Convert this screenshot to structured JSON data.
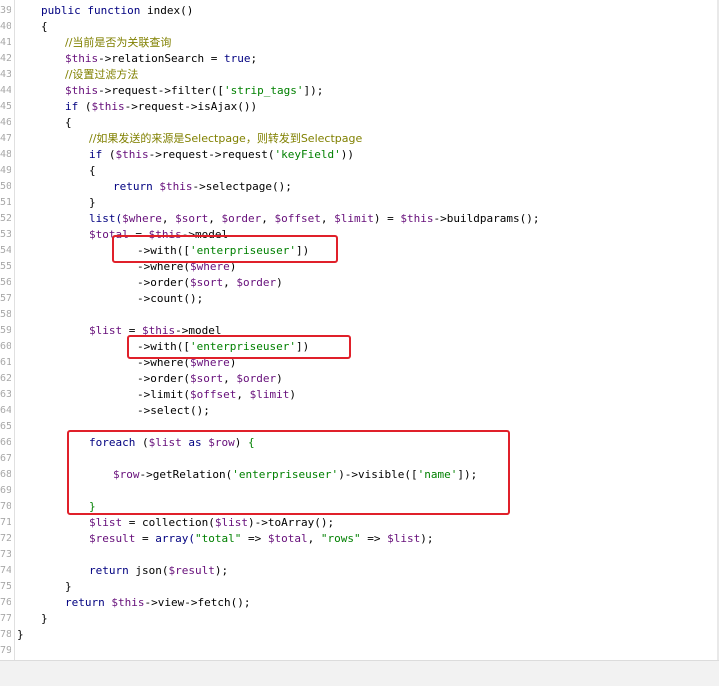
{
  "editor": {
    "lines": [
      {
        "num": "39",
        "indent": 0,
        "tokens": [
          {
            "t": "public ",
            "c": "kw"
          },
          {
            "t": "function ",
            "c": "kw"
          },
          {
            "t": "index()",
            "c": "plain"
          }
        ]
      },
      {
        "num": "40",
        "indent": 0,
        "tokens": [
          {
            "t": "{",
            "c": "plain"
          }
        ]
      },
      {
        "num": "41",
        "indent": 1,
        "tokens": [
          {
            "t": "//当前是否为关联查询",
            "c": "cmt"
          }
        ]
      },
      {
        "num": "42",
        "indent": 1,
        "tokens": [
          {
            "t": "$this",
            "c": "var"
          },
          {
            "t": "->relationSearch = ",
            "c": "plain"
          },
          {
            "t": "true",
            "c": "kw"
          },
          {
            "t": ";",
            "c": "plain"
          }
        ]
      },
      {
        "num": "43",
        "indent": 1,
        "tokens": [
          {
            "t": "//设置过滤方法",
            "c": "cmt"
          }
        ]
      },
      {
        "num": "44",
        "indent": 1,
        "tokens": [
          {
            "t": "$this",
            "c": "var"
          },
          {
            "t": "->request->filter([",
            "c": "plain"
          },
          {
            "t": "'strip_tags'",
            "c": "str"
          },
          {
            "t": "]);",
            "c": "plain"
          }
        ]
      },
      {
        "num": "45",
        "indent": 1,
        "tokens": [
          {
            "t": "if ",
            "c": "kw"
          },
          {
            "t": "(",
            "c": "plain"
          },
          {
            "t": "$this",
            "c": "var"
          },
          {
            "t": "->request->isAjax())",
            "c": "plain"
          }
        ]
      },
      {
        "num": "46",
        "indent": 1,
        "tokens": [
          {
            "t": "{",
            "c": "plain"
          }
        ]
      },
      {
        "num": "47",
        "indent": 2,
        "tokens": [
          {
            "t": "//如果发送的来源是Selectpage，则转发到Selectpage",
            "c": "cmt"
          }
        ]
      },
      {
        "num": "48",
        "indent": 2,
        "tokens": [
          {
            "t": "if ",
            "c": "kw"
          },
          {
            "t": "(",
            "c": "plain"
          },
          {
            "t": "$this",
            "c": "var"
          },
          {
            "t": "->request->request(",
            "c": "plain"
          },
          {
            "t": "'keyField'",
            "c": "str"
          },
          {
            "t": "))",
            "c": "plain"
          }
        ]
      },
      {
        "num": "49",
        "indent": 2,
        "tokens": [
          {
            "t": "{",
            "c": "plain"
          }
        ]
      },
      {
        "num": "50",
        "indent": 3,
        "tokens": [
          {
            "t": "return ",
            "c": "kw"
          },
          {
            "t": "$this",
            "c": "var"
          },
          {
            "t": "->selectpage();",
            "c": "plain"
          }
        ]
      },
      {
        "num": "51",
        "indent": 2,
        "tokens": [
          {
            "t": "}",
            "c": "plain"
          }
        ]
      },
      {
        "num": "52",
        "indent": 2,
        "tokens": [
          {
            "t": "list(",
            "c": "kw"
          },
          {
            "t": "$where",
            "c": "var"
          },
          {
            "t": ", ",
            "c": "plain"
          },
          {
            "t": "$sort",
            "c": "var"
          },
          {
            "t": ", ",
            "c": "plain"
          },
          {
            "t": "$order",
            "c": "var"
          },
          {
            "t": ", ",
            "c": "plain"
          },
          {
            "t": "$offset",
            "c": "var"
          },
          {
            "t": ", ",
            "c": "plain"
          },
          {
            "t": "$limit",
            "c": "var"
          },
          {
            "t": ") = ",
            "c": "plain"
          },
          {
            "t": "$this",
            "c": "var"
          },
          {
            "t": "->buildparams();",
            "c": "plain"
          }
        ]
      },
      {
        "num": "53",
        "indent": 2,
        "tokens": [
          {
            "t": "$total",
            "c": "var"
          },
          {
            "t": " = ",
            "c": "plain"
          },
          {
            "t": "$this",
            "c": "var"
          },
          {
            "t": "->model",
            "c": "plain"
          }
        ]
      },
      {
        "num": "54",
        "indent": 4,
        "tokens": [
          {
            "t": "->with([",
            "c": "plain"
          },
          {
            "t": "'enterpriseuser'",
            "c": "str"
          },
          {
            "t": "])",
            "c": "plain"
          }
        ]
      },
      {
        "num": "55",
        "indent": 4,
        "tokens": [
          {
            "t": "->where(",
            "c": "plain"
          },
          {
            "t": "$where",
            "c": "var"
          },
          {
            "t": ")",
            "c": "plain"
          }
        ]
      },
      {
        "num": "56",
        "indent": 4,
        "tokens": [
          {
            "t": "->order(",
            "c": "plain"
          },
          {
            "t": "$sort",
            "c": "var"
          },
          {
            "t": ", ",
            "c": "plain"
          },
          {
            "t": "$order",
            "c": "var"
          },
          {
            "t": ")",
            "c": "plain"
          }
        ]
      },
      {
        "num": "57",
        "indent": 4,
        "tokens": [
          {
            "t": "->count();",
            "c": "plain"
          }
        ]
      },
      {
        "num": "58",
        "indent": 0,
        "tokens": []
      },
      {
        "num": "59",
        "indent": 2,
        "tokens": [
          {
            "t": "$list",
            "c": "var"
          },
          {
            "t": " = ",
            "c": "plain"
          },
          {
            "t": "$this",
            "c": "var"
          },
          {
            "t": "->model",
            "c": "plain"
          }
        ]
      },
      {
        "num": "60",
        "indent": 4,
        "tokens": [
          {
            "t": "->with([",
            "c": "plain"
          },
          {
            "t": "'enterpriseuser'",
            "c": "str"
          },
          {
            "t": "])",
            "c": "plain"
          }
        ]
      },
      {
        "num": "61",
        "indent": 4,
        "tokens": [
          {
            "t": "->where(",
            "c": "plain"
          },
          {
            "t": "$where",
            "c": "var"
          },
          {
            "t": ")",
            "c": "plain"
          }
        ]
      },
      {
        "num": "62",
        "indent": 4,
        "tokens": [
          {
            "t": "->order(",
            "c": "plain"
          },
          {
            "t": "$sort",
            "c": "var"
          },
          {
            "t": ", ",
            "c": "plain"
          },
          {
            "t": "$order",
            "c": "var"
          },
          {
            "t": ")",
            "c": "plain"
          }
        ]
      },
      {
        "num": "63",
        "indent": 4,
        "tokens": [
          {
            "t": "->limit(",
            "c": "plain"
          },
          {
            "t": "$offset",
            "c": "var"
          },
          {
            "t": ", ",
            "c": "plain"
          },
          {
            "t": "$limit",
            "c": "var"
          },
          {
            "t": ")",
            "c": "plain"
          }
        ]
      },
      {
        "num": "64",
        "indent": 4,
        "tokens": [
          {
            "t": "->select();",
            "c": "plain"
          }
        ]
      },
      {
        "num": "65",
        "indent": 0,
        "tokens": []
      },
      {
        "num": "66",
        "indent": 2,
        "tokens": [
          {
            "t": "foreach ",
            "c": "kw"
          },
          {
            "t": "(",
            "c": "plain"
          },
          {
            "t": "$list",
            "c": "var"
          },
          {
            "t": " as ",
            "c": "kw"
          },
          {
            "t": "$row",
            "c": "var"
          },
          {
            "t": ") ",
            "c": "plain"
          },
          {
            "t": "{",
            "c": "str"
          }
        ]
      },
      {
        "num": "67",
        "indent": 0,
        "tokens": []
      },
      {
        "num": "68",
        "indent": 3,
        "tokens": [
          {
            "t": "$row",
            "c": "var"
          },
          {
            "t": "->getRelation(",
            "c": "plain"
          },
          {
            "t": "'enterpriseuser'",
            "c": "str"
          },
          {
            "t": ")->visible([",
            "c": "plain"
          },
          {
            "t": "'name'",
            "c": "str"
          },
          {
            "t": "]);",
            "c": "plain"
          }
        ]
      },
      {
        "num": "69",
        "indent": 0,
        "tokens": []
      },
      {
        "num": "70",
        "indent": 2,
        "tokens": [
          {
            "t": "}",
            "c": "str"
          }
        ]
      },
      {
        "num": "71",
        "indent": 2,
        "tokens": [
          {
            "t": "$list",
            "c": "var"
          },
          {
            "t": " = collection(",
            "c": "plain"
          },
          {
            "t": "$list",
            "c": "var"
          },
          {
            "t": ")->toArray();",
            "c": "plain"
          }
        ]
      },
      {
        "num": "72",
        "indent": 2,
        "tokens": [
          {
            "t": "$result",
            "c": "var"
          },
          {
            "t": " = ",
            "c": "plain"
          },
          {
            "t": "array(",
            "c": "kw"
          },
          {
            "t": "\"total\"",
            "c": "str"
          },
          {
            "t": " => ",
            "c": "plain"
          },
          {
            "t": "$total",
            "c": "var"
          },
          {
            "t": ", ",
            "c": "plain"
          },
          {
            "t": "\"rows\"",
            "c": "str"
          },
          {
            "t": " => ",
            "c": "plain"
          },
          {
            "t": "$list",
            "c": "var"
          },
          {
            "t": ");",
            "c": "plain"
          }
        ]
      },
      {
        "num": "73",
        "indent": 0,
        "tokens": []
      },
      {
        "num": "74",
        "indent": 2,
        "tokens": [
          {
            "t": "return ",
            "c": "kw"
          },
          {
            "t": "json(",
            "c": "plain"
          },
          {
            "t": "$result",
            "c": "var"
          },
          {
            "t": ");",
            "c": "plain"
          }
        ]
      },
      {
        "num": "75",
        "indent": 1,
        "tokens": [
          {
            "t": "}",
            "c": "plain"
          }
        ]
      },
      {
        "num": "76",
        "indent": 1,
        "tokens": [
          {
            "t": "return ",
            "c": "kw"
          },
          {
            "t": "$this",
            "c": "var"
          },
          {
            "t": "->view->fetch();",
            "c": "plain"
          }
        ]
      },
      {
        "num": "77",
        "indent": 0,
        "tokens": [
          {
            "t": "}",
            "c": "plain"
          }
        ]
      },
      {
        "num": "78",
        "indent": -1,
        "tokens": [
          {
            "t": "}",
            "c": "plain"
          }
        ]
      },
      {
        "num": "79",
        "indent": 0,
        "tokens": []
      }
    ]
  },
  "colors": {
    "keyword": "#000080",
    "variable": "#660e7a",
    "string": "#008000",
    "comment": "#808000",
    "highlight_box": "#e0202a"
  }
}
